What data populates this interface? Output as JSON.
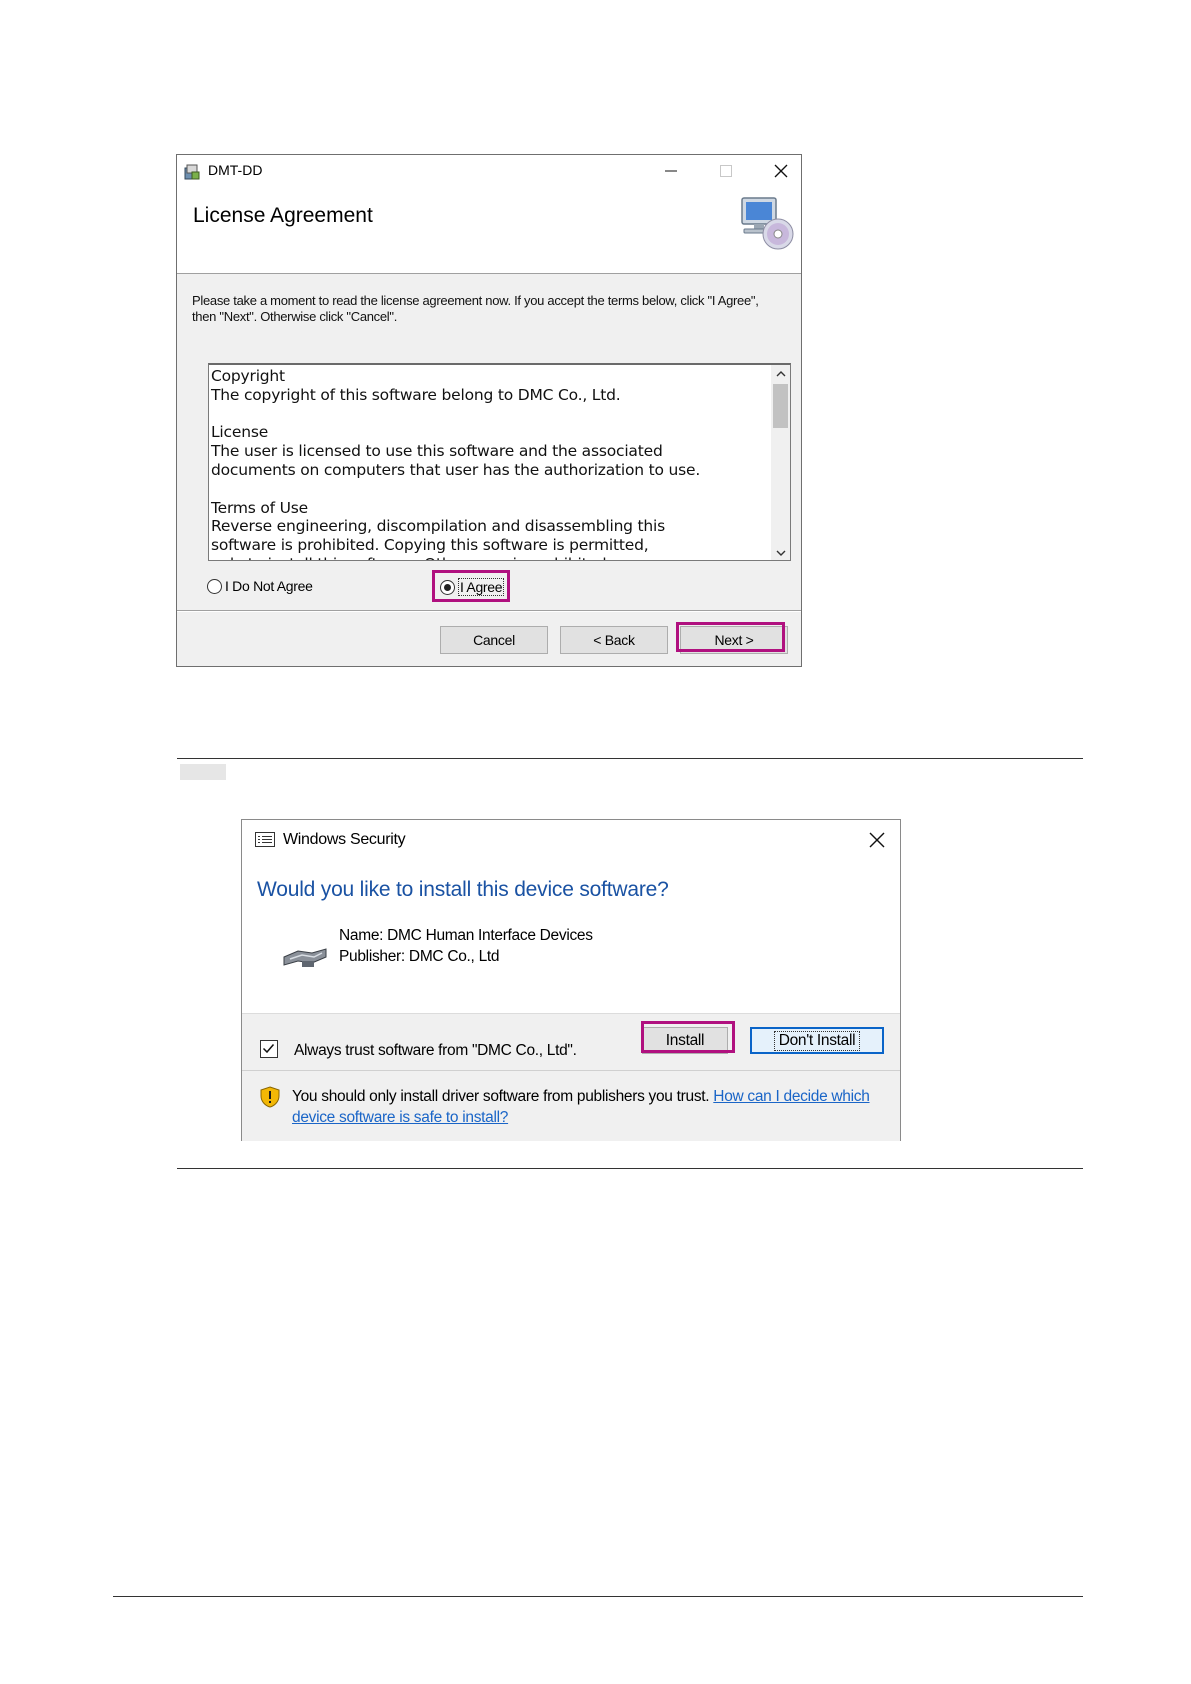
{
  "installer": {
    "app_title": "DMT-DD",
    "heading": "License Agreement",
    "description": "Please take a moment to read the license agreement now. If you accept the terms below, click \"I Agree\", then \"Next\". Otherwise click \"Cancel\".",
    "license_text": "Copyright\nThe copyright of this software belong to DMC Co., Ltd.\n\nLicense\nThe user is licensed to use this software and the associated\ndocuments on computers that user has the authorization to use.\n\nTerms of Use\nReverse engineering, discompilation and disassembling this\nsoftware is prohibited. Copying this software is permitted,\nonly to install this software. Other copy is prohibited.",
    "radio_not_agree": "I Do Not Agree",
    "radio_agree": "I Agree",
    "selected_option": "I Agree",
    "buttons": {
      "cancel": "Cancel",
      "back": "< Back",
      "next": "Next >"
    }
  },
  "security_dialog": {
    "title": "Windows Security",
    "question": "Would you like to install this device software?",
    "name_line": "Name: DMC Human Interface Devices",
    "publisher_line": "Publisher: DMC Co., Ltd",
    "always_trust": "Always trust software from \"DMC Co., Ltd\".",
    "always_trust_checked": true,
    "install_button": "Install",
    "dont_install_button": "Don't Install",
    "warning_text": "You should only install driver software from publishers you trust.",
    "help_link": "How can I decide which device software is safe to install?"
  },
  "colors": {
    "highlight": "#b0107f",
    "link": "#1a65c7",
    "question": "#1a52a3"
  }
}
